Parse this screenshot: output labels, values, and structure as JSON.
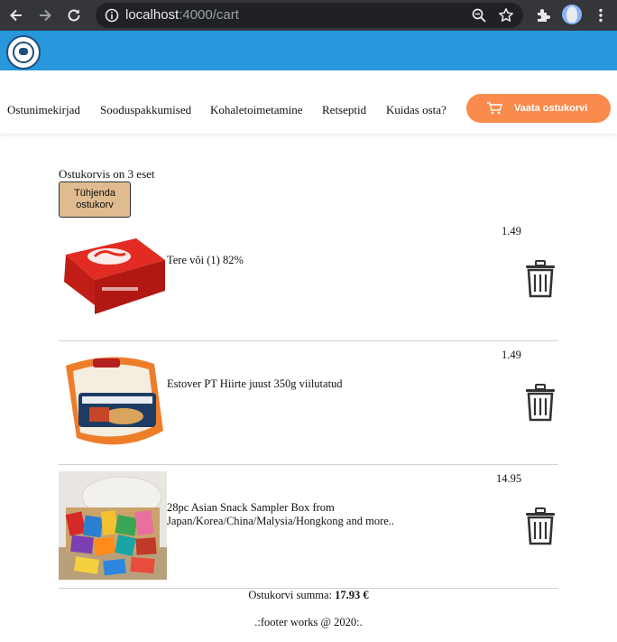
{
  "browser": {
    "url_host": "localhost",
    "url_rest": ":4000/cart"
  },
  "menu": {
    "items": [
      {
        "label": "Ostunimekirjad"
      },
      {
        "label": "Sooduspakkumised"
      },
      {
        "label": "Kohaletoimetamine"
      },
      {
        "label": "Retseptid"
      },
      {
        "label": "Kuidas osta?"
      }
    ],
    "cart_button": "Vaata ostukorvi"
  },
  "cart": {
    "count_text": "Ostukorvis on 3 eset",
    "empty_button": "Tühjenda ostukorv",
    "items": [
      {
        "name": "Tere või (1) 82%",
        "price": "1.49",
        "icon": "trash-icon"
      },
      {
        "name": "Estover PT Hiirte juust 350g viilutatud",
        "price": "1.49",
        "icon": "trash-icon"
      },
      {
        "name": "28pc Asian Snack Sampler Box from Japan/Korea/China/Malysia/Hongkong and more..",
        "price": "14.95",
        "icon": "trash-icon"
      }
    ],
    "total_label": "Ostukorvi summa:",
    "total_value": "17.93 €"
  },
  "footer": {
    "text": ".:footer works @ 2020:."
  },
  "colors": {
    "header": "#2897dc",
    "cart_button": "#f98b4d",
    "empty_button": "#dfbb8f"
  }
}
